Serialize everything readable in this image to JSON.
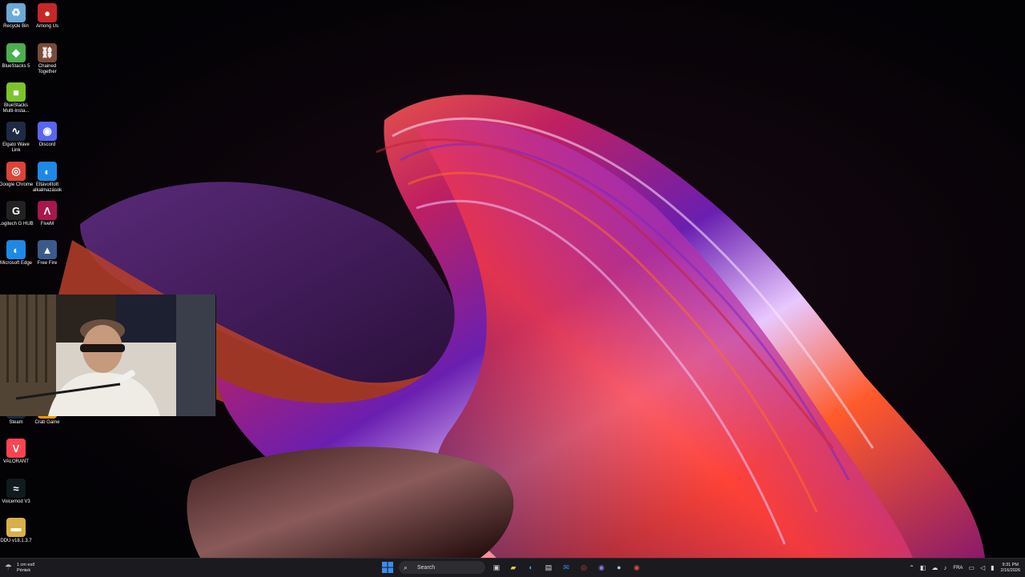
{
  "desktop": {
    "icons": [
      {
        "label": "Recycle Bin",
        "icon": "recycle-bin-icon",
        "color": "#6aa9d8",
        "glyph": "♻"
      },
      {
        "label": "Among Us",
        "icon": "among-us-icon",
        "color": "#c62828",
        "glyph": "●"
      },
      {
        "label": "BlueStacks 5",
        "icon": "bluestacks-icon",
        "color": "#4caf50",
        "glyph": "◆"
      },
      {
        "label": "Chained Together",
        "icon": "chained-together-icon",
        "color": "#7a4a3a",
        "glyph": "⛓"
      },
      {
        "label": "BlueStacks Multi-Insta...",
        "icon": "bluestacks-multi-icon",
        "color": "#7cc32e",
        "glyph": "■"
      },
      {
        "label": "Elgato Wave Link",
        "icon": "elgato-wave-link-icon",
        "color": "#1f2a44",
        "glyph": "∿"
      },
      {
        "label": "Discord",
        "icon": "discord-icon",
        "color": "#5865f2",
        "glyph": "◉"
      },
      {
        "label": "Google Chrome",
        "icon": "chrome-icon",
        "color": "#db4437",
        "glyph": "◎"
      },
      {
        "label": "Eltávolított alkalmazások",
        "icon": "edge-icon",
        "color": "#1e88e5",
        "glyph": "◐"
      },
      {
        "label": "Logitech G HUB",
        "icon": "logitech-ghub-icon",
        "color": "#222222",
        "glyph": "G"
      },
      {
        "label": "FiveM",
        "icon": "fivem-icon",
        "color": "#a8174d",
        "glyph": "Λ"
      },
      {
        "label": "Microsoft Edge",
        "icon": "edge-icon",
        "color": "#1e88e5",
        "glyph": "◐"
      },
      {
        "label": "Free Fire",
        "icon": "free-fire-icon",
        "color": "#3a5a8c",
        "glyph": "▲"
      },
      {
        "label": "Steam",
        "icon": "steam-icon",
        "color": "#1b2838",
        "glyph": "●"
      },
      {
        "label": "Crab Game",
        "icon": "crab-game-icon",
        "color": "#ff9800",
        "glyph": "◇"
      },
      {
        "label": "VALORANT",
        "icon": "valorant-icon",
        "color": "#fa4454",
        "glyph": "V"
      },
      {
        "label": "Voicemod V3",
        "icon": "voicemod-icon",
        "color": "#0f1b1f",
        "glyph": "≈"
      },
      {
        "label": "DDU v18.1.3.7",
        "icon": "ddu-icon",
        "color": "#d8b04a",
        "glyph": "▬"
      }
    ]
  },
  "taskbar": {
    "weather": {
      "line1": "1 cm eső",
      "line2": "Péntek"
    },
    "search_placeholder": "Search",
    "language": "FRA",
    "clock": {
      "time": "9:31 PM",
      "date": "2/16/2026"
    }
  },
  "colors": {
    "taskbar_bg": "#1b1a1f",
    "start_blue": "#3c8cf0"
  }
}
